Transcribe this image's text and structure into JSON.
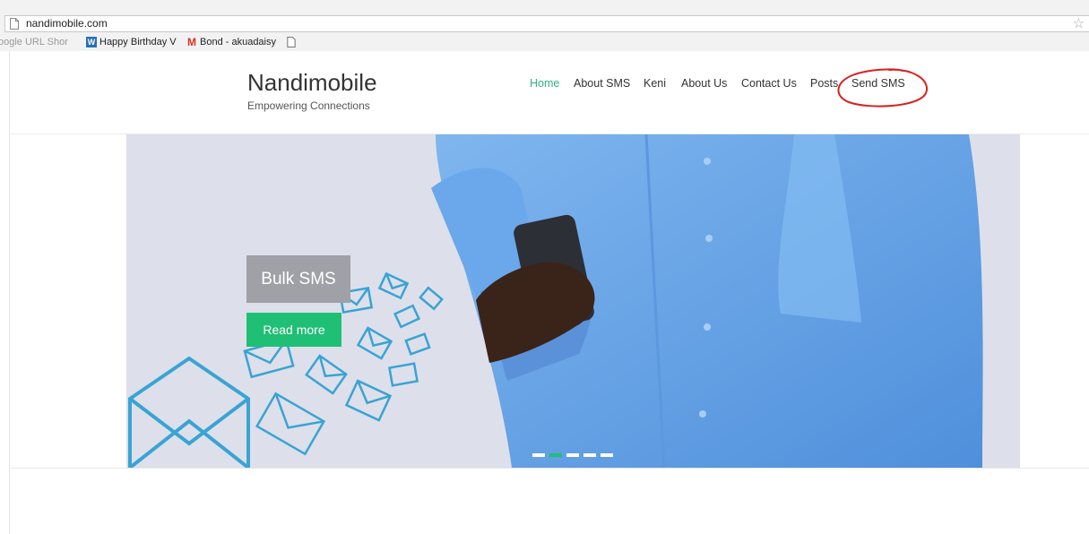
{
  "browser": {
    "url": "nandimobile.com",
    "bookmarks": [
      {
        "label": "oogle URL Shor",
        "icon": "page-icon"
      },
      {
        "label": "Happy Birthday V",
        "icon": "w-icon"
      },
      {
        "label": "Bond - akuadaisy",
        "icon": "gmail-icon"
      },
      {
        "label": "",
        "icon": "page-icon"
      }
    ]
  },
  "site": {
    "title": "Nandimobile",
    "tagline": "Empowering Connections"
  },
  "nav": {
    "items": [
      "Home",
      "About SMS",
      "Keni",
      "About Us",
      "Contact Us",
      "Posts",
      "Send SMS"
    ],
    "active_index": 0,
    "active_color": "#2fb47c"
  },
  "hero": {
    "title": "Bulk SMS",
    "button": "Read more",
    "slides": 5,
    "active_slide": 1,
    "accent": "#1fbf76"
  },
  "annotation": {
    "color": "#d9201f",
    "target": "Send SMS"
  }
}
